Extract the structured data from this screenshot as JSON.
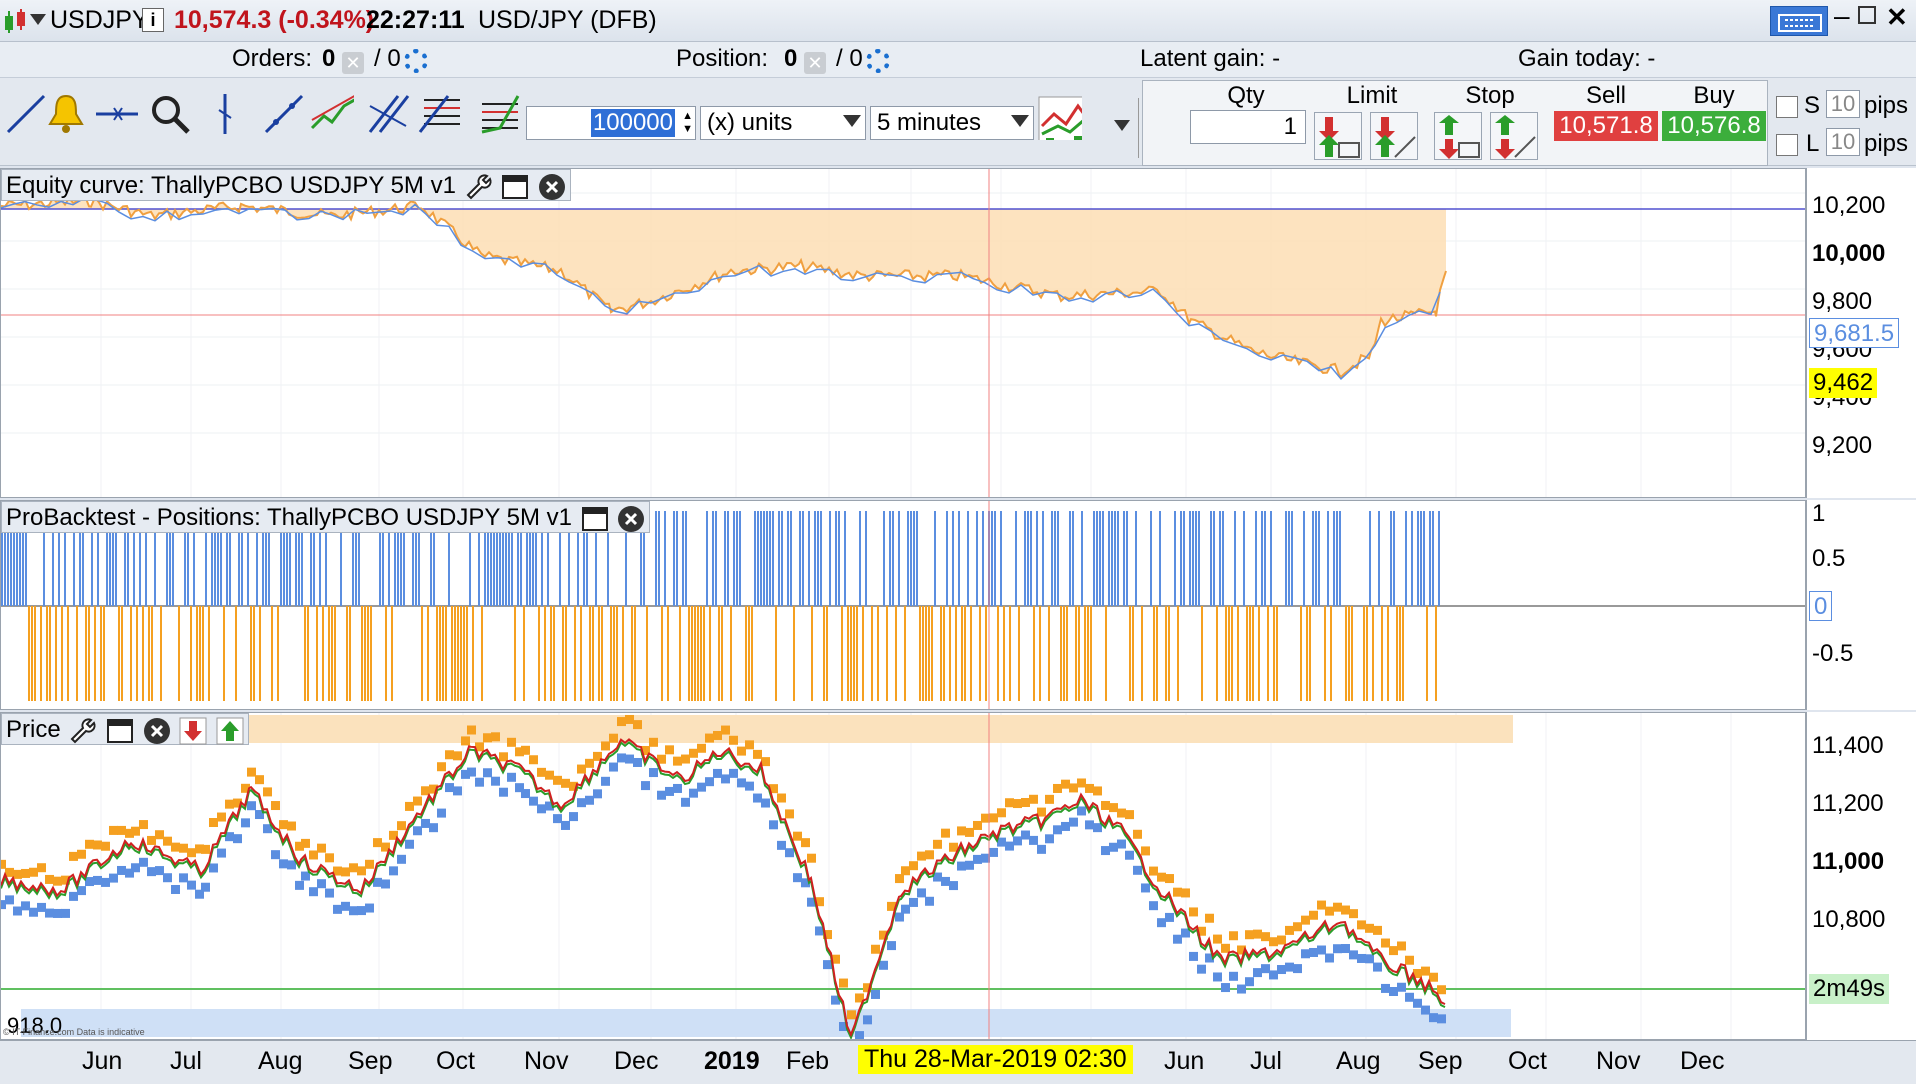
{
  "title_bar": {
    "symbol": "USDJPY",
    "price_change": "10,574.3 (-0.34%)",
    "time": "22:27:11",
    "instrument": "USD/JPY (DFB)"
  },
  "order_bar": {
    "orders_label": "Orders:",
    "orders_value": "0",
    "orders_pending": "/ 0",
    "position_label": "Position:",
    "position_value": "0",
    "position_pending": "/ 0",
    "latent_gain": "Latent gain: -",
    "gain_today": "Gain today: -"
  },
  "toolbar": {
    "quantity": "100000",
    "units": "(x) units",
    "timeframe": "5 minutes",
    "qty_label": "Qty",
    "qty_value": "1",
    "limit_label": "Limit",
    "stop_label": "Stop",
    "sell_label": "Sell",
    "sell_price": "10,571.8",
    "buy_label": "Buy",
    "buy_price": "10,576.8",
    "s_label": "S",
    "s_pips_value": "10",
    "s_pips_label": "pips",
    "l_label": "L",
    "l_pips_value": "10",
    "l_pips_label": "pips"
  },
  "equity_panel": {
    "title": "Equity curve: ThallyPCBO USDJPY 5M v1",
    "ticks": [
      "10,200",
      "10,000",
      "9,800",
      "9,600",
      "9,400",
      "9,200"
    ],
    "current_tag": "9,681.5",
    "level_tag": "9,462"
  },
  "positions_panel": {
    "title": "ProBacktest - Positions: ThallyPCBO USDJPY 5M v1",
    "ticks": [
      "1",
      "0.5",
      "0",
      "-0.5"
    ]
  },
  "price_panel": {
    "title": "Price",
    "ticks": [
      "11,400",
      "11,200",
      "11,000",
      "10,800"
    ],
    "timer_tag": "2m49s",
    "bottom_left": "918.0",
    "copyright": "© IT-Finance.com  Data is indicative"
  },
  "date_axis": {
    "months": [
      "Jun",
      "Jul",
      "Aug",
      "Sep",
      "Oct",
      "Nov",
      "Dec",
      "2019",
      "Feb",
      "Jun",
      "Jul",
      "Aug",
      "Sep",
      "Oct",
      "Nov",
      "Dec"
    ],
    "cursor_date": "Thu 28-Mar-2019 02:30"
  },
  "colors": {
    "sell": "#e04040",
    "buy": "#3cae3c",
    "equity_fill": "#fde0b8",
    "long_bars": "#5b8ee0",
    "short_bars": "#f5a020",
    "highlight": "#ffff00"
  }
}
